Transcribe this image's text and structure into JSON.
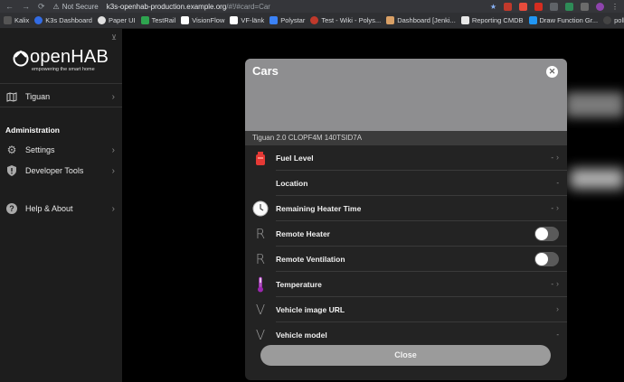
{
  "browser": {
    "secure_label": "Not Secure",
    "url_host": "k3s-openhab-production.example.org",
    "url_path": "/#!/#card=Car",
    "bookmarks": [
      "Kalix",
      "K3s Dashboard",
      "Paper UI",
      "TestRail",
      "VisionFlow",
      "VF-länk",
      "Polystar",
      "Test - Wiki - Polys...",
      "Dashboard [Jenki...",
      "Reporting CMDB",
      "Draw Function Gr...",
      "polly/"
    ]
  },
  "sidebar": {
    "logo_text": "openHAB",
    "logo_tagline": "empowering the smart home",
    "items": [
      {
        "label": "Tiguan"
      },
      {
        "label": "Settings"
      },
      {
        "label": "Developer Tools"
      },
      {
        "label": "Help & About"
      }
    ],
    "admin_title": "Administration"
  },
  "modal": {
    "title": "Cars",
    "subtitle": "Tiguan 2.0 CLOPF4M 140TSID7A",
    "rows": [
      {
        "label": "Fuel Level",
        "value": "-"
      },
      {
        "label": "Location",
        "value": "-"
      },
      {
        "label": "Remaining Heater Time",
        "value": "-"
      },
      {
        "label": "Remote Heater"
      },
      {
        "label": "Remote Ventilation"
      },
      {
        "label": "Temperature",
        "value": "-"
      },
      {
        "label": "Vehicle image URL"
      },
      {
        "label": "Vehicle model",
        "value": "-"
      }
    ],
    "close_label": "Close",
    "letter_icons": [
      "R",
      "R",
      "V",
      "V"
    ]
  },
  "colors": {
    "accent": "#e64a19",
    "toggle_off": "#5a5a5a",
    "header": "#8e8e90"
  }
}
